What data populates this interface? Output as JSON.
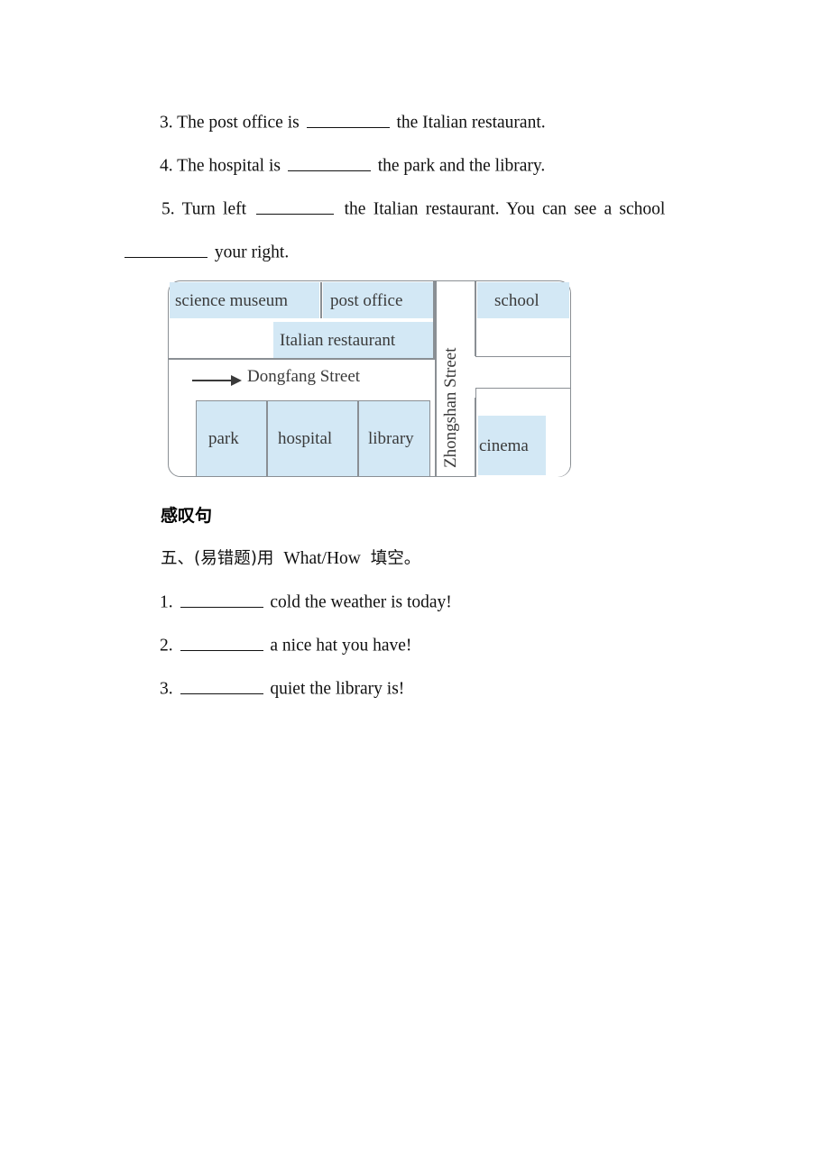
{
  "worksheet": {
    "questions_top": [
      {
        "number": "3.",
        "pre": "The post office is",
        "post": "the Italian restaurant."
      },
      {
        "number": "4.",
        "pre": "The hospital is",
        "post": "the park and the library."
      },
      {
        "number": "5.",
        "pre": "Turn left",
        "post": "the Italian restaurant. You can see a school",
        "continuation": "your right."
      }
    ],
    "section": {
      "heading_cn": "感叹句",
      "instruction_prefix": "五、(易错题)用",
      "instruction_keyword": "What/How",
      "instruction_suffix": "填空。"
    },
    "questions_bottom": [
      {
        "number": "1.",
        "text": "cold the weather is today!"
      },
      {
        "number": "2.",
        "text": "a nice hat you have!"
      },
      {
        "number": "3.",
        "text": "quiet the library is!"
      }
    ]
  },
  "map": {
    "street_horizontal": "Dongfang Street",
    "street_vertical": "Zhongshan Street",
    "blocks": {
      "science_museum": "science museum",
      "post_office": "post office",
      "italian_restaurant": "Italian restaurant",
      "school": "school",
      "park": "park",
      "hospital": "hospital",
      "library": "library",
      "cinema": "cinema"
    },
    "colors": {
      "highlight": "#d3e8f5",
      "border": "#8a8f94",
      "text": "#3a3a3a"
    }
  }
}
